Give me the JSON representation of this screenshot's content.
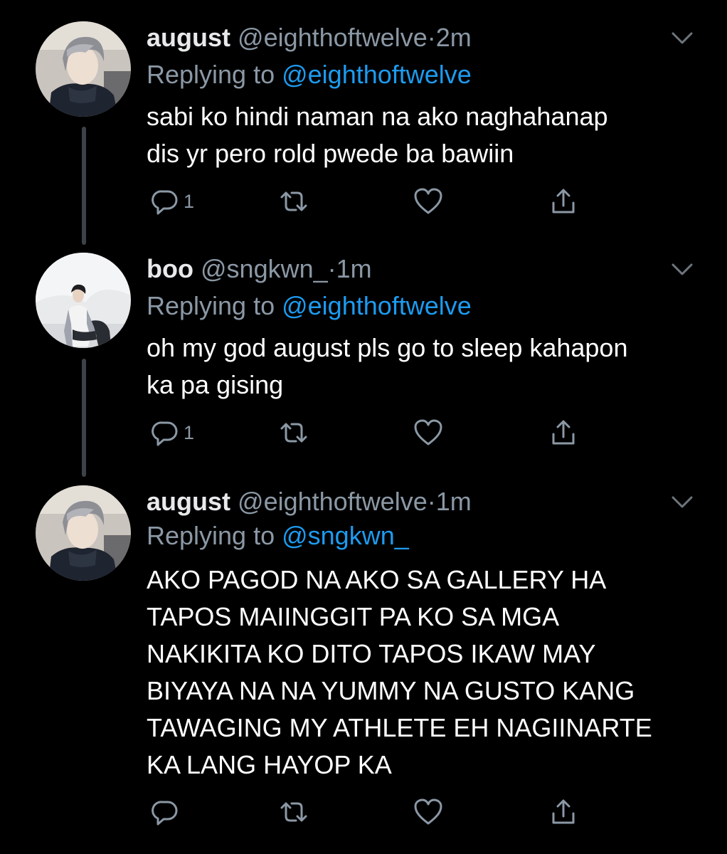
{
  "colors": {
    "background": "#000000",
    "text": "#ffffff",
    "muted": "#8b98a5",
    "link": "#1d9bf0",
    "thread_line": "#3d4247"
  },
  "tweets": [
    {
      "name": "august",
      "handle": "@eighthoftwelve",
      "dot": "·",
      "time": "2m",
      "replying_prefix": "Replying to ",
      "replying_to": "@eighthoftwelve",
      "text": "sabi ko hindi naman na ako naghahanap\ndis yr pero rold pwede ba bawiin",
      "reply_count": "1",
      "icons": [
        "reply-icon",
        "retweet-icon",
        "like-icon",
        "share-icon",
        "chevron-down-icon"
      ]
    },
    {
      "name": "boo",
      "handle": "@sngkwn_",
      "dot": "·",
      "time": "1m",
      "replying_prefix": "Replying to ",
      "replying_to": "@eighthoftwelve",
      "text": "oh my god august pls go to sleep kahapon\nka pa gising",
      "reply_count": "1",
      "icons": [
        "reply-icon",
        "retweet-icon",
        "like-icon",
        "share-icon",
        "chevron-down-icon"
      ]
    },
    {
      "name": "august",
      "handle": "@eighthoftwelve",
      "dot": "·",
      "time": "1m",
      "replying_prefix": "Replying to ",
      "replying_to": "@sngkwn_",
      "text": "AKO PAGOD NA AKO SA GALLERY HA\nTAPOS MAIINGGIT PA KO SA MGA\nNAKIKITA KO DITO TAPOS IKAW MAY\nBIYAYA NA NA YUMMY NA GUSTO KANG\nTAWAGING MY ATHLETE EH NAGIINARTE\nKA LANG HAYOP KA",
      "reply_count": "",
      "icons": [
        "reply-icon",
        "retweet-icon",
        "like-icon",
        "share-icon",
        "chevron-down-icon"
      ]
    }
  ]
}
